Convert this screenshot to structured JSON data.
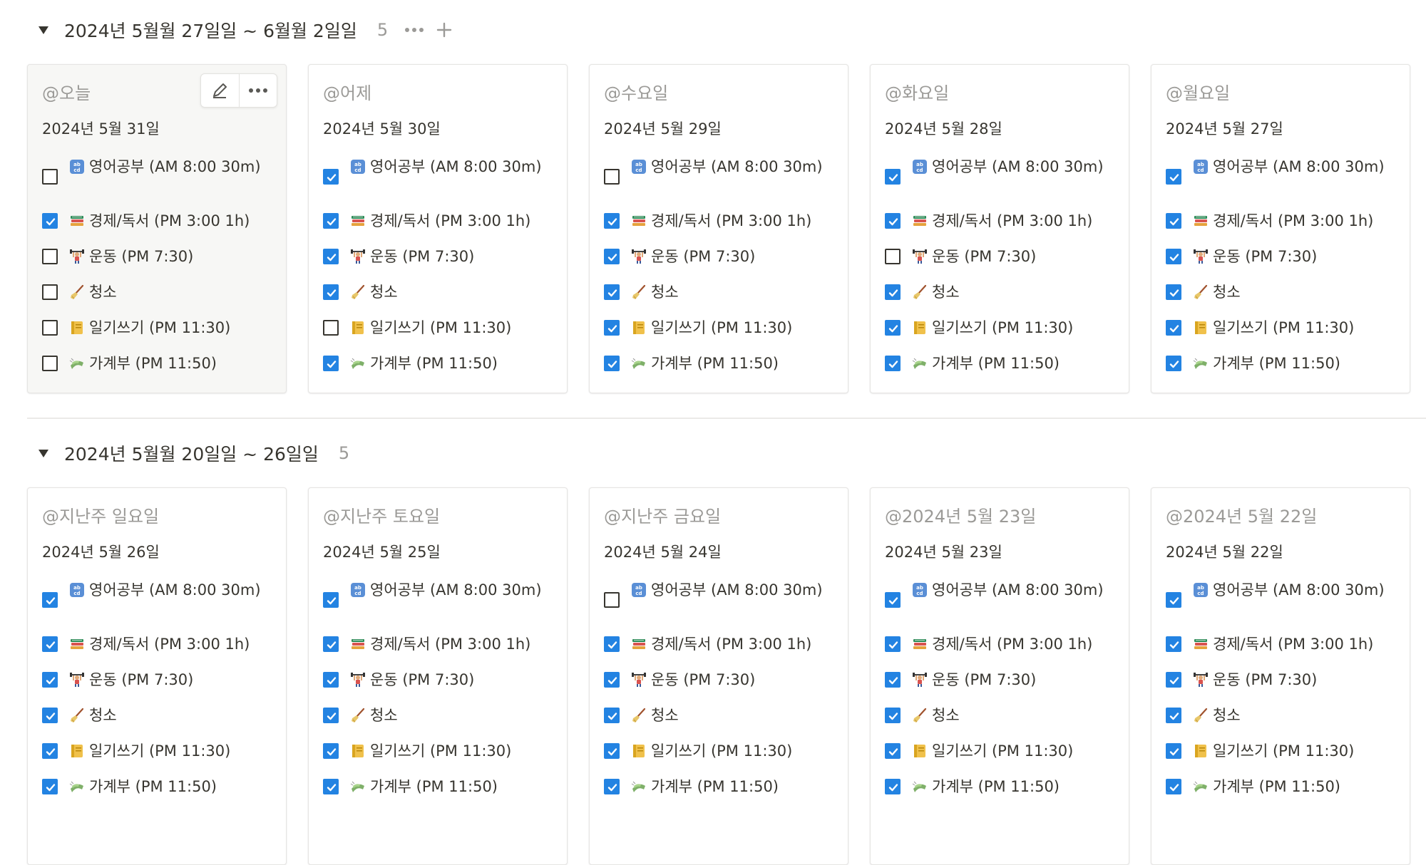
{
  "groups": [
    {
      "title": "2024년 5월월 27일일 ~ 6월월 2일일",
      "count": "5",
      "show_actions": true,
      "cards": [
        {
          "title": "@오늘",
          "date": "2024년 5월 31일",
          "hover": true,
          "tasks": [
            {
              "emoji": "abcd",
              "text": "영어공부 (AM 8:00 30m)",
              "checked": false
            },
            {
              "emoji": "books",
              "text": "경제/독서 (PM 3:00 1h)",
              "checked": true
            },
            {
              "emoji": "lifter",
              "text": "운동 (PM 7:30)",
              "checked": false
            },
            {
              "emoji": "broom",
              "text": "청소",
              "checked": false
            },
            {
              "emoji": "ledger",
              "text": "일기쓰기 (PM 11:30)",
              "checked": false
            },
            {
              "emoji": "money",
              "text": "가계부 (PM 11:50)",
              "checked": false
            }
          ]
        },
        {
          "title": "@어제",
          "date": "2024년 5월 30일",
          "tasks": [
            {
              "emoji": "abcd",
              "text": "영어공부 (AM 8:00 30m)",
              "checked": true
            },
            {
              "emoji": "books",
              "text": "경제/독서 (PM 3:00 1h)",
              "checked": true
            },
            {
              "emoji": "lifter",
              "text": "운동 (PM 7:30)",
              "checked": true
            },
            {
              "emoji": "broom",
              "text": "청소",
              "checked": true
            },
            {
              "emoji": "ledger",
              "text": "일기쓰기 (PM 11:30)",
              "checked": false
            },
            {
              "emoji": "money",
              "text": "가계부 (PM 11:50)",
              "checked": true
            }
          ]
        },
        {
          "title": "@수요일",
          "date": "2024년 5월 29일",
          "tasks": [
            {
              "emoji": "abcd",
              "text": "영어공부 (AM 8:00 30m)",
              "checked": false
            },
            {
              "emoji": "books",
              "text": "경제/독서 (PM 3:00 1h)",
              "checked": true
            },
            {
              "emoji": "lifter",
              "text": "운동 (PM 7:30)",
              "checked": true
            },
            {
              "emoji": "broom",
              "text": "청소",
              "checked": true
            },
            {
              "emoji": "ledger",
              "text": "일기쓰기 (PM 11:30)",
              "checked": true
            },
            {
              "emoji": "money",
              "text": "가계부 (PM 11:50)",
              "checked": true
            }
          ]
        },
        {
          "title": "@화요일",
          "date": "2024년 5월 28일",
          "tasks": [
            {
              "emoji": "abcd",
              "text": "영어공부 (AM 8:00 30m)",
              "checked": true
            },
            {
              "emoji": "books",
              "text": "경제/독서 (PM 3:00 1h)",
              "checked": true
            },
            {
              "emoji": "lifter",
              "text": "운동 (PM 7:30)",
              "checked": false
            },
            {
              "emoji": "broom",
              "text": "청소",
              "checked": true
            },
            {
              "emoji": "ledger",
              "text": "일기쓰기 (PM 11:30)",
              "checked": true
            },
            {
              "emoji": "money",
              "text": "가계부 (PM 11:50)",
              "checked": true
            }
          ]
        },
        {
          "title": "@월요일",
          "date": "2024년 5월 27일",
          "tasks": [
            {
              "emoji": "abcd",
              "text": "영어공부 (AM 8:00 30m)",
              "checked": true
            },
            {
              "emoji": "books",
              "text": "경제/독서 (PM 3:00 1h)",
              "checked": true
            },
            {
              "emoji": "lifter",
              "text": "운동 (PM 7:30)",
              "checked": true
            },
            {
              "emoji": "broom",
              "text": "청소",
              "checked": true
            },
            {
              "emoji": "ledger",
              "text": "일기쓰기 (PM 11:30)",
              "checked": true
            },
            {
              "emoji": "money",
              "text": "가계부 (PM 11:50)",
              "checked": true
            }
          ]
        }
      ]
    },
    {
      "title": "2024년 5월월 20일일 ~ 26일일",
      "count": "5",
      "show_actions": false,
      "cards": [
        {
          "title": "@지난주 일요일",
          "date": "2024년 5월 26일",
          "tasks": [
            {
              "emoji": "abcd",
              "text": "영어공부 (AM 8:00 30m)",
              "checked": true
            },
            {
              "emoji": "books",
              "text": "경제/독서 (PM 3:00 1h)",
              "checked": true
            },
            {
              "emoji": "lifter",
              "text": "운동 (PM 7:30)",
              "checked": true
            },
            {
              "emoji": "broom",
              "text": "청소",
              "checked": true
            },
            {
              "emoji": "ledger",
              "text": "일기쓰기 (PM 11:30)",
              "checked": true
            },
            {
              "emoji": "money",
              "text": "가계부 (PM 11:50)",
              "checked": true
            }
          ]
        },
        {
          "title": "@지난주 토요일",
          "date": "2024년 5월 25일",
          "tasks": [
            {
              "emoji": "abcd",
              "text": "영어공부 (AM 8:00 30m)",
              "checked": true
            },
            {
              "emoji": "books",
              "text": "경제/독서 (PM 3:00 1h)",
              "checked": true
            },
            {
              "emoji": "lifter",
              "text": "운동 (PM 7:30)",
              "checked": true
            },
            {
              "emoji": "broom",
              "text": "청소",
              "checked": true
            },
            {
              "emoji": "ledger",
              "text": "일기쓰기 (PM 11:30)",
              "checked": true
            },
            {
              "emoji": "money",
              "text": "가계부 (PM 11:50)",
              "checked": true
            }
          ]
        },
        {
          "title": "@지난주 금요일",
          "date": "2024년 5월 24일",
          "tasks": [
            {
              "emoji": "abcd",
              "text": "영어공부 (AM 8:00 30m)",
              "checked": false
            },
            {
              "emoji": "books",
              "text": "경제/독서 (PM 3:00 1h)",
              "checked": true
            },
            {
              "emoji": "lifter",
              "text": "운동 (PM 7:30)",
              "checked": true
            },
            {
              "emoji": "broom",
              "text": "청소",
              "checked": true
            },
            {
              "emoji": "ledger",
              "text": "일기쓰기 (PM 11:30)",
              "checked": true
            },
            {
              "emoji": "money",
              "text": "가계부 (PM 11:50)",
              "checked": true
            }
          ]
        },
        {
          "title": "@2024년 5월 23일",
          "date": "2024년 5월 23일",
          "tasks": [
            {
              "emoji": "abcd",
              "text": "영어공부 (AM 8:00 30m)",
              "checked": true
            },
            {
              "emoji": "books",
              "text": "경제/독서 (PM 3:00 1h)",
              "checked": true
            },
            {
              "emoji": "lifter",
              "text": "운동 (PM 7:30)",
              "checked": true
            },
            {
              "emoji": "broom",
              "text": "청소",
              "checked": true
            },
            {
              "emoji": "ledger",
              "text": "일기쓰기 (PM 11:30)",
              "checked": true
            },
            {
              "emoji": "money",
              "text": "가계부 (PM 11:50)",
              "checked": true
            }
          ]
        },
        {
          "title": "@2024년 5월 22일",
          "date": "2024년 5월 22일",
          "tasks": [
            {
              "emoji": "abcd",
              "text": "영어공부 (AM 8:00 30m)",
              "checked": true
            },
            {
              "emoji": "books",
              "text": "경제/독서 (PM 3:00 1h)",
              "checked": true
            },
            {
              "emoji": "lifter",
              "text": "운동 (PM 7:30)",
              "checked": true
            },
            {
              "emoji": "broom",
              "text": "청소",
              "checked": true
            },
            {
              "emoji": "ledger",
              "text": "일기쓰기 (PM 11:30)",
              "checked": true
            },
            {
              "emoji": "money",
              "text": "가계부 (PM 11:50)",
              "checked": true
            }
          ]
        }
      ]
    }
  ]
}
